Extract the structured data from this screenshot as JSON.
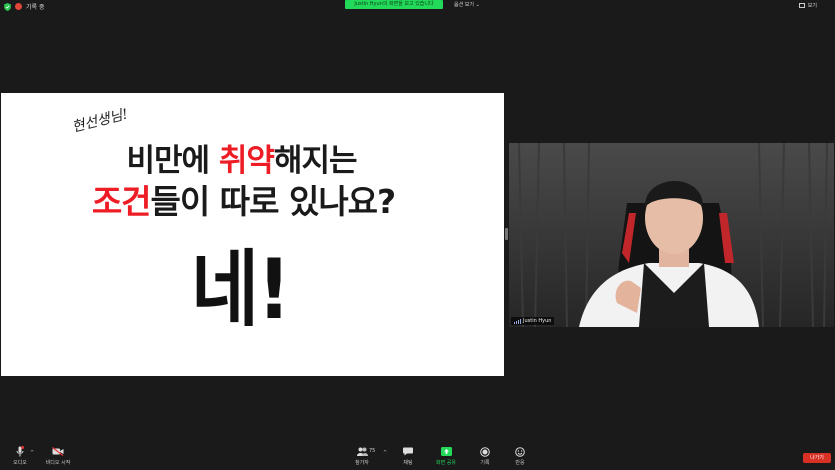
{
  "top_bar": {
    "recording_label": "기록 중",
    "sharing_banner": "Justin Hyun의 화면을 보고 있습니다",
    "view_options_label": "옵션 보기 ⌄",
    "view_button_label": "보기"
  },
  "slide": {
    "handwriting": "현선생님!",
    "line1_plain_a": "비만에 ",
    "line1_red": "취약",
    "line1_plain_b": "해지는",
    "line2_red": "조건",
    "line2_plain": "들이 따로 있나요?",
    "answer": "네!"
  },
  "video": {
    "participant_name": "Justin Hyun"
  },
  "toolbar": {
    "audio_label": "오디오",
    "video_label": "비디오 시작",
    "participants_label": "참가자",
    "participants_count": "75",
    "chat_label": "채팅",
    "share_screen_label": "화면 공유",
    "record_label": "기록",
    "reactions_label": "반응",
    "leave_label": "나가기"
  },
  "colors": {
    "accent_green": "#23d959",
    "leave_red": "#d93025",
    "slide_red": "#ee1c24"
  }
}
